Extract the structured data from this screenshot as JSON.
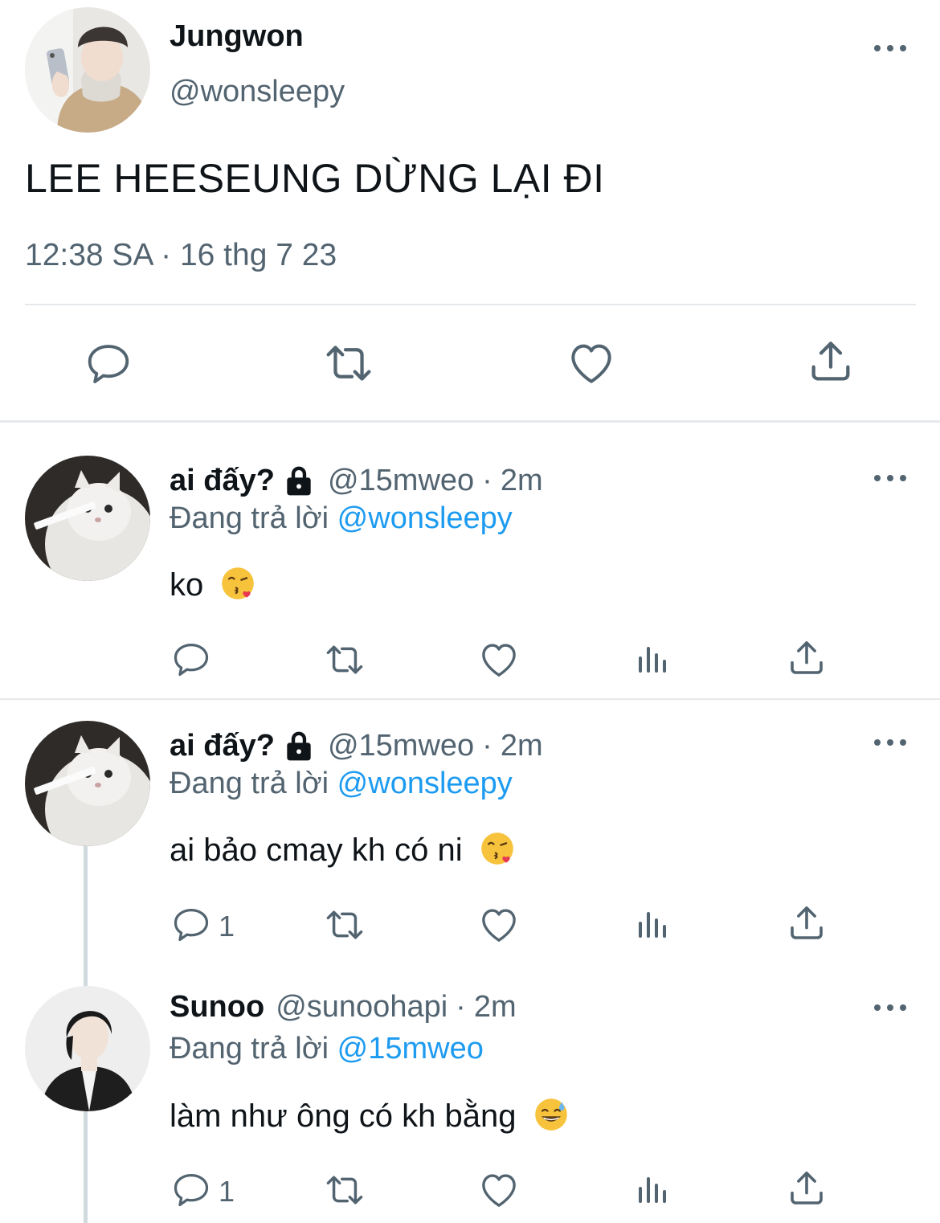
{
  "main_tweet": {
    "author_name": "Jungwon",
    "handle": "@wonsleepy",
    "text": "LEE HEESEUNG DỪNG LẠI ĐI",
    "timestamp": "12:38 SA · 16 thg 7 23",
    "actions": [
      "reply-icon",
      "retweet-icon",
      "like-icon",
      "share-icon"
    ]
  },
  "replies": [
    {
      "author_name": "ai đấy?",
      "handle": "@15mweo",
      "sep": "·",
      "time": "2m",
      "replying_prefix": "Đang trả lời",
      "replying_to": "@wonsleepy",
      "text": "ko",
      "emoji": "kissing-heart-emoji",
      "reply_count": ""
    },
    {
      "author_name": "ai đấy?",
      "handle": "@15mweo",
      "sep": "·",
      "time": "2m",
      "replying_prefix": "Đang trả lời",
      "replying_to": "@wonsleepy",
      "text": "ai bảo cmay kh có ni",
      "emoji": "kissing-heart-emoji",
      "reply_count": "1"
    },
    {
      "author_name": "Sunoo",
      "handle": "@sunoohapi",
      "sep": "·",
      "time": "2m",
      "replying_prefix": "Đang trả lời",
      "replying_to": "@15mweo",
      "text": "làm như ông có kh bằng",
      "emoji": "grinning-sweat-emoji",
      "reply_count": "1"
    }
  ],
  "colors": {
    "text": "#0f1419",
    "secondary": "#536471",
    "link": "#1d9bf0",
    "divider": "#e6e9ec"
  }
}
